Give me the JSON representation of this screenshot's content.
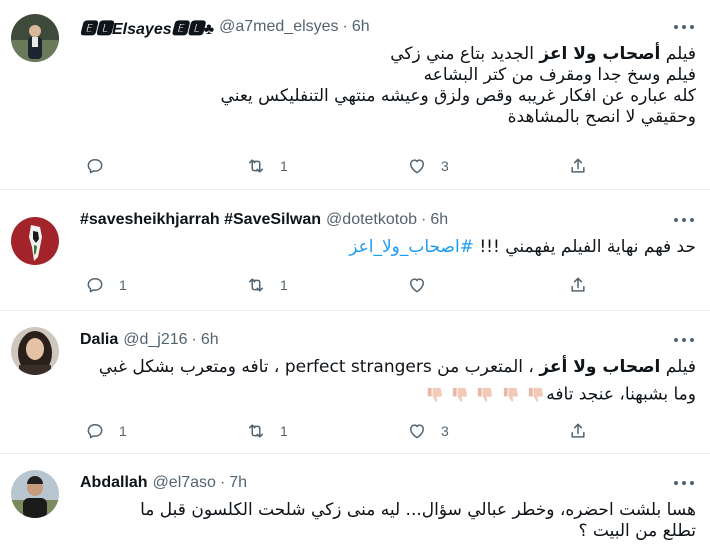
{
  "tweets": [
    {
      "name": "🅴🅻🔷 Elsayes 🅴🅻 ♣",
      "name_display": "🅴🅻Elsayes🅴🅻♣",
      "handle": "@a7med_elsyes",
      "dot": "·",
      "time": "6h",
      "lines": [
        {
          "pre": "فيلم ",
          "bold": "أصحاب ولا اعز",
          "post": " الجديد بتاع مني زكي"
        },
        {
          "text": "فيلم وسخ جدا ومقرف من كتر البشاعه"
        },
        {
          "text": "كله عباره عن افكار غريبه وقص ولزق وعيشه منتهي التنفليكس يعني"
        },
        {
          "text": "وحقيقي لا انصح بالمشاهدة"
        }
      ],
      "replies": "",
      "retweets": "1",
      "likes": "3"
    },
    {
      "name": "#savesheikhjarrah #SaveSilwan",
      "handle": "@dotetkotob",
      "dot": "·",
      "time": "6h",
      "lines": [
        {
          "pre": "حد فهم نهاية الفيلم يفهمني !!! ",
          "hashtag": "#اصحاب_ولا_اعز"
        }
      ],
      "replies": "1",
      "retweets": "1",
      "likes": ""
    },
    {
      "name": "Dalia",
      "handle": "@d_j216",
      "dot": "·",
      "time": "6h",
      "lines": [
        {
          "pre": "فيلم ",
          "bold": "اصحاب ولا أعز",
          "post": " ، المتعرب من perfect strangers ،  تافه ومتعرب بشكل غبي"
        },
        {
          "text": "وما بشبهنا، عنجد تافه",
          "emoji": "👎🏻👎🏻👎🏻👎🏻👎🏻"
        }
      ],
      "replies": "1",
      "retweets": "1",
      "likes": "3"
    },
    {
      "name": "Abdallah",
      "handle": "@el7aso",
      "dot": "·",
      "time": "7h",
      "lines": [
        {
          "text": "هسا بلشت احضره، وخطر عبالي سؤال... ليه منى زكي شلحت الكلسون قبل ما"
        },
        {
          "text": "تطلع من البيت ؟"
        }
      ],
      "replies": "",
      "retweets": "",
      "likes": ""
    }
  ],
  "colors": {
    "accent": "#1d9bf0",
    "muted": "#536471",
    "text": "#0f1419",
    "divider": "#e6ecf0"
  },
  "icons": {
    "reply": "reply-icon",
    "retweet": "retweet-icon",
    "like": "heart-icon",
    "share": "share-icon",
    "more": "more-dots-icon"
  }
}
